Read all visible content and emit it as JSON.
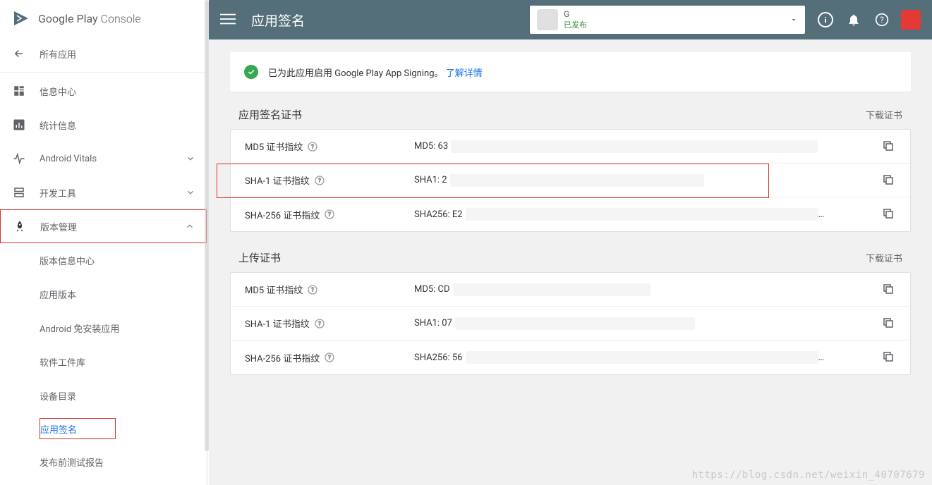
{
  "brand": {
    "name": "Google Play",
    "suffix": "Console"
  },
  "header": {
    "title": "应用签名",
    "appSelector": {
      "name": "G",
      "status": "已发布"
    }
  },
  "sidebar": {
    "back": "所有应用",
    "items": [
      {
        "label": "信息中心"
      },
      {
        "label": "统计信息"
      },
      {
        "label": "Android Vitals"
      },
      {
        "label": "开发工具"
      },
      {
        "label": "版本管理"
      }
    ],
    "subitems": [
      {
        "label": "版本信息中心"
      },
      {
        "label": "应用版本"
      },
      {
        "label": "Android 免安装应用"
      },
      {
        "label": "软件工件库"
      },
      {
        "label": "设备目录"
      },
      {
        "label": "应用签名"
      },
      {
        "label": "发布前测试报告"
      }
    ]
  },
  "banner": {
    "text": "已为此应用启用 Google Play App Signing。",
    "link": "了解详情"
  },
  "sections": {
    "signing": {
      "title": "应用签名证书",
      "download": "下载证书",
      "rows": [
        {
          "label": "MD5 证书指纹",
          "prefix": "MD5: 63"
        },
        {
          "label": "SHA-1 证书指纹",
          "prefix": "SHA1: 2"
        },
        {
          "label": "SHA-256 证书指纹",
          "prefix": "SHA256: E2"
        }
      ]
    },
    "upload": {
      "title": "上传证书",
      "download": "下载证书",
      "rows": [
        {
          "label": "MD5 证书指纹",
          "prefix": "MD5: CD"
        },
        {
          "label": "SHA-1 证书指纹",
          "prefix": "SHA1: 07"
        },
        {
          "label": "SHA-256 证书指纹",
          "prefix": "SHA256: 56"
        }
      ]
    }
  },
  "watermark": "https://blog.csdn.net/weixin_40707679"
}
